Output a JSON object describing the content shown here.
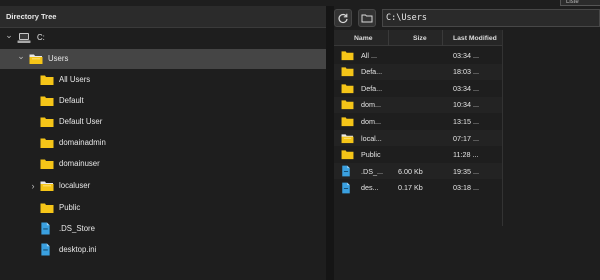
{
  "left_panel": {
    "title": "Directory Tree"
  },
  "tree": [
    {
      "label": "C:",
      "type": "drive",
      "expand": "down"
    },
    {
      "label": "Users",
      "type": "folder-open",
      "expand": "down",
      "selected": true
    },
    {
      "label": "All Users",
      "type": "folder"
    },
    {
      "label": "Default",
      "type": "folder"
    },
    {
      "label": "Default User",
      "type": "folder"
    },
    {
      "label": "domainadmin",
      "type": "folder"
    },
    {
      "label": "domainuser",
      "type": "folder"
    },
    {
      "label": "localuser",
      "type": "folder-open",
      "expand": "right"
    },
    {
      "label": "Public",
      "type": "folder"
    },
    {
      "label": ".DS_Store",
      "type": "file"
    },
    {
      "label": "desktop.ini",
      "type": "file"
    }
  ],
  "toolbar": {
    "path": "C:\\Users",
    "refresh_icon": "refresh-icon",
    "folder_icon": "folder-icon"
  },
  "table": {
    "columns": [
      "Name",
      "Size",
      "Last Modified"
    ],
    "rows": [
      {
        "name": "All ...",
        "size": "",
        "modified": "03:34 ...",
        "type": "folder"
      },
      {
        "name": "Defa...",
        "size": "",
        "modified": "18:03 ...",
        "type": "folder"
      },
      {
        "name": "Defa...",
        "size": "",
        "modified": "03:34 ...",
        "type": "folder"
      },
      {
        "name": "dom...",
        "size": "",
        "modified": "10:34 ...",
        "type": "folder"
      },
      {
        "name": "dom...",
        "size": "",
        "modified": "13:15 ...",
        "type": "folder"
      },
      {
        "name": "local...",
        "size": "",
        "modified": "07:17 ...",
        "type": "folder-open"
      },
      {
        "name": "Public",
        "size": "",
        "modified": "11:28 ...",
        "type": "folder"
      },
      {
        "name": ".DS_...",
        "size": "6.00 Kb",
        "modified": "19:35 ...",
        "type": "file"
      },
      {
        "name": "des...",
        "size": "0.17 Kb",
        "modified": "03:18 ...",
        "type": "file"
      }
    ]
  },
  "colors": {
    "folder": "#f5c518",
    "file": "#3aa0e0",
    "selected_row": "#454545"
  },
  "tab_fragment": "Liste"
}
